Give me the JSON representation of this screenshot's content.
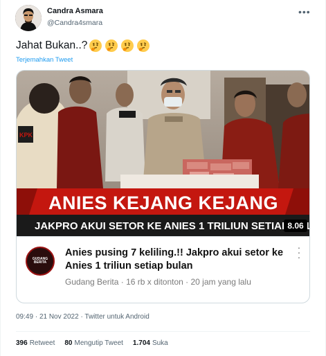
{
  "user": {
    "name": "Candra Asmara",
    "handle": "@Candra4smara"
  },
  "tweet": {
    "text": "Jahat Bukan..?",
    "translate_label": "Terjemahkan Tweet"
  },
  "video": {
    "headline": "ANIES KEJANG KEJANG",
    "ticker": "JAKPRO AKUI SETOR KE ANIES 1 TRILIUN SETIAP BUL",
    "duration": "8.06",
    "vest_label": "KPK",
    "title": "Anies pusing 7 keliling.!! Jakpro akui setor ke Anies 1 triliun setiap bulan",
    "channel": "Gudang Berita",
    "views": "16 rb x ditonton",
    "age": "20 jam yang lalu",
    "meta_separator": "·",
    "channel_logo_text": "GUDANG BERITA"
  },
  "footer": {
    "time": "09:49",
    "date": "21 Nov 2022",
    "client": "Twitter untuk Android",
    "separator": "·"
  },
  "stats": {
    "retweets_count": "396",
    "retweets_label": "Retweet",
    "quotes_count": "80",
    "quotes_label": "Mengutip Tweet",
    "likes_count": "1.704",
    "likes_label": "Suka"
  },
  "colors": {
    "link": "#1d9bf0",
    "banner_red": "#c4170f",
    "banner_dark": "#1a1a1a"
  }
}
